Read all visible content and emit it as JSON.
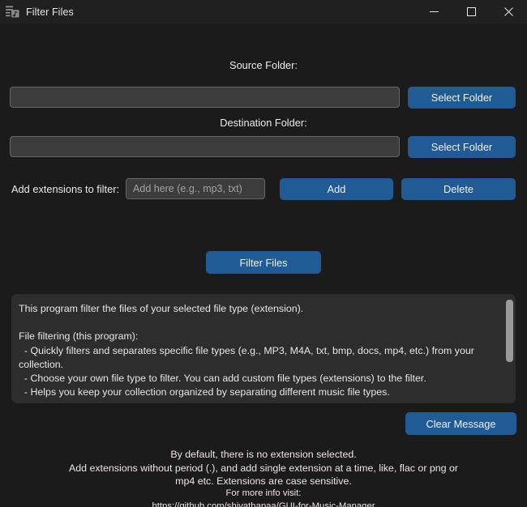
{
  "window": {
    "title": "Filter Files",
    "icon": "music-list-icon",
    "controls": {
      "minimize": "minimize-icon",
      "maximize": "maximize-icon",
      "close": "close-icon"
    }
  },
  "theme": {
    "background": "#1b1b1b",
    "titlebar": "#202020",
    "accent": "#215b95",
    "input_bg": "#3c3c3c",
    "input_border": "#666666",
    "panel_bg": "#2d2d2d",
    "text": "#e8e6e3",
    "note_text": "#f0e3e3",
    "scrollbar_thumb": "#9a9a9a"
  },
  "source": {
    "label": "Source Folder:",
    "value": "",
    "placeholder": "",
    "button": "Select Folder"
  },
  "destination": {
    "label": "Destination Folder:",
    "value": "",
    "placeholder": "",
    "button": "Select Folder"
  },
  "extensions": {
    "label": "Add extensions to filter:",
    "value": "",
    "placeholder": "Add here (e.g., mp3, txt)",
    "add_button": "Add",
    "delete_button": "Delete"
  },
  "actions": {
    "filter_button": "Filter Files",
    "clear_button": "Clear Message"
  },
  "message": {
    "text": "This program filter the files of your selected file type (extension).\n\nFile filtering (this program):\n  - Quickly filters and separates specific file types (e.g., MP3, M4A, txt, bmp, docs, mp4, etc.) from your collection.\n  - Choose your own file type to filter. You can add custom file types (extensions) to the filter.\n  - Helps you keep your collection organized by separating different music file types."
  },
  "footer": {
    "note_line1": "By default, there is no extension selected.",
    "note_line2": "Add extensions without period (.), and add single extension at a time, like, flac or png or",
    "note_line3": "mp4 etc. Extensions are case sensitive.",
    "info_label": "For more info visit:",
    "info_url": "https://github.com/shivathapaa/GUI-for-Music-Manager"
  }
}
